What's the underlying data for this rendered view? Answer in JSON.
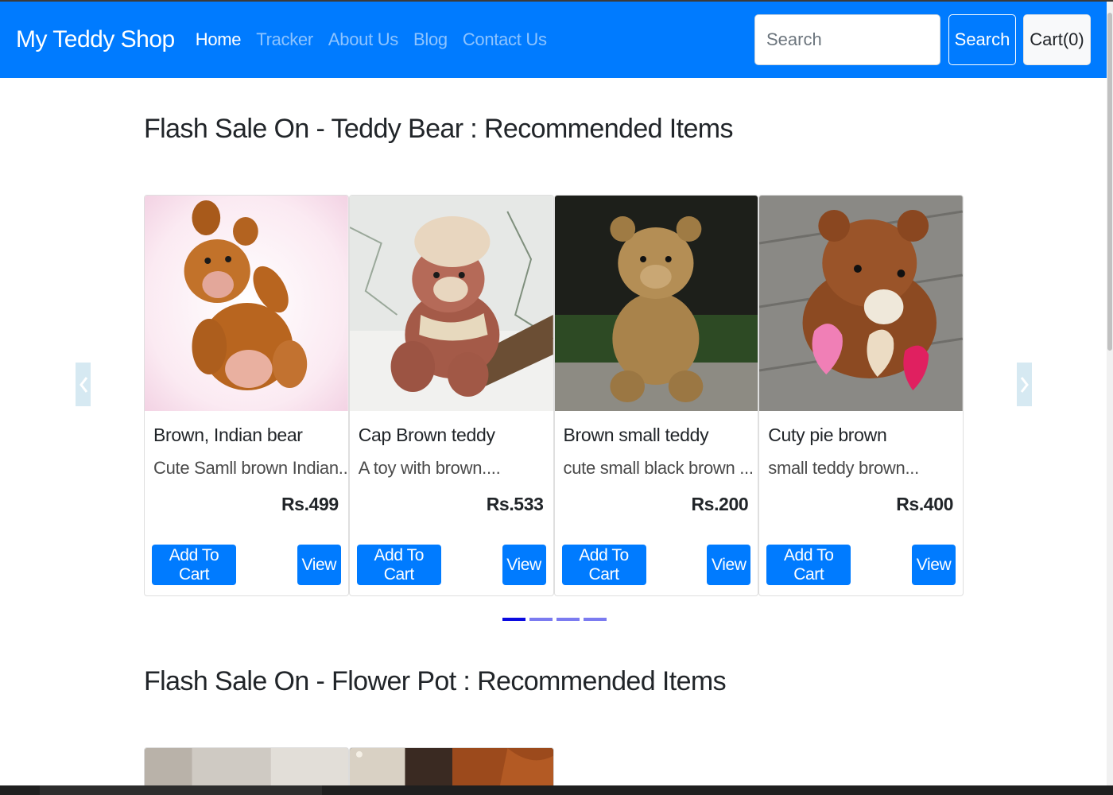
{
  "navbar": {
    "brand": "My Teddy Shop",
    "links": [
      {
        "label": "Home",
        "active": true
      },
      {
        "label": "Tracker",
        "active": false
      },
      {
        "label": "About Us",
        "active": false
      },
      {
        "label": "Blog",
        "active": false
      },
      {
        "label": "Contact Us",
        "active": false
      }
    ],
    "search_placeholder": "Search",
    "search_button": "Search",
    "cart_button": "Cart(0)"
  },
  "sections": [
    {
      "title": "Flash Sale On - Teddy Bear : Recommended Items",
      "products": [
        {
          "name": "Brown, Indian bear",
          "description": "Cute Samll brown Indian...",
          "price": "Rs.499",
          "add_label": "Add To Cart",
          "view_label": "View"
        },
        {
          "name": "Cap Brown teddy",
          "description": "A toy with brown....",
          "price": "Rs.533",
          "add_label": "Add To Cart",
          "view_label": "View"
        },
        {
          "name": "Brown small teddy",
          "description": "cute small black brown ...",
          "price": "Rs.200",
          "add_label": "Add To Cart",
          "view_label": "View"
        },
        {
          "name": "Cuty pie brown",
          "description": "small teddy brown...",
          "price": "Rs.400",
          "add_label": "Add To Cart",
          "view_label": "View"
        }
      ],
      "carousel": {
        "slides": 4,
        "active_slide": 1,
        "prev_icon": "chevron-left-icon",
        "next_icon": "chevron-right-icon"
      }
    },
    {
      "title": "Flash Sale On - Flower Pot : Recommended Items"
    }
  ],
  "colors": {
    "primary": "#007bff",
    "indicator_active": "#0a0ae0",
    "indicator_inactive": "#7b7bf0",
    "control_bg": "#d6e9f2"
  }
}
